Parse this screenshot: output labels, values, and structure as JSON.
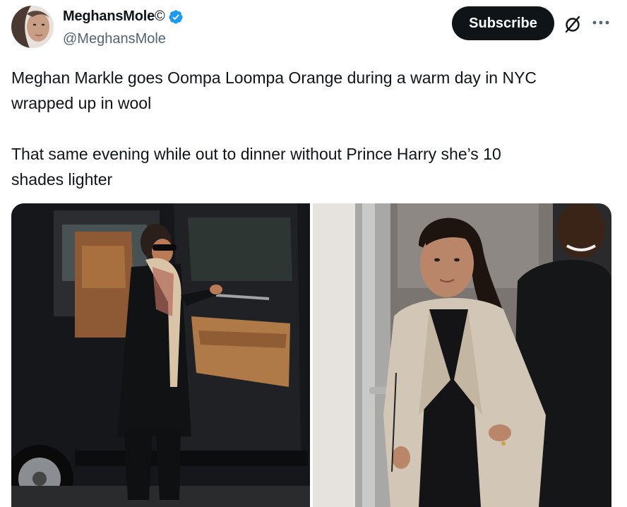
{
  "author": {
    "display_name": "MeghansMole",
    "name_suffix": "©",
    "handle": "@MeghansMole",
    "verified": true,
    "verified_color": "#1d9bf0"
  },
  "actions": {
    "subscribe_label": "Subscribe",
    "grok_icon": "grok-icon",
    "more_icon": "more-icon"
  },
  "tweet": {
    "text": "Meghan Markle goes Oompa Loompa Orange during a warm day in NYC\nwrapped up in wool\n\nThat same evening while out to dinner without Prince Harry she’s 10\nshades lighter"
  },
  "media": {
    "count": 2,
    "items": [
      {
        "kind": "photo",
        "subject": "woman in dark coat and scarf stepping into black SUV"
      },
      {
        "kind": "photo",
        "subject": "woman in beige blazer walking out, man in black behind"
      }
    ]
  },
  "colors": {
    "text": "#0f1419",
    "secondary": "#536471",
    "button": "#0f1419"
  }
}
